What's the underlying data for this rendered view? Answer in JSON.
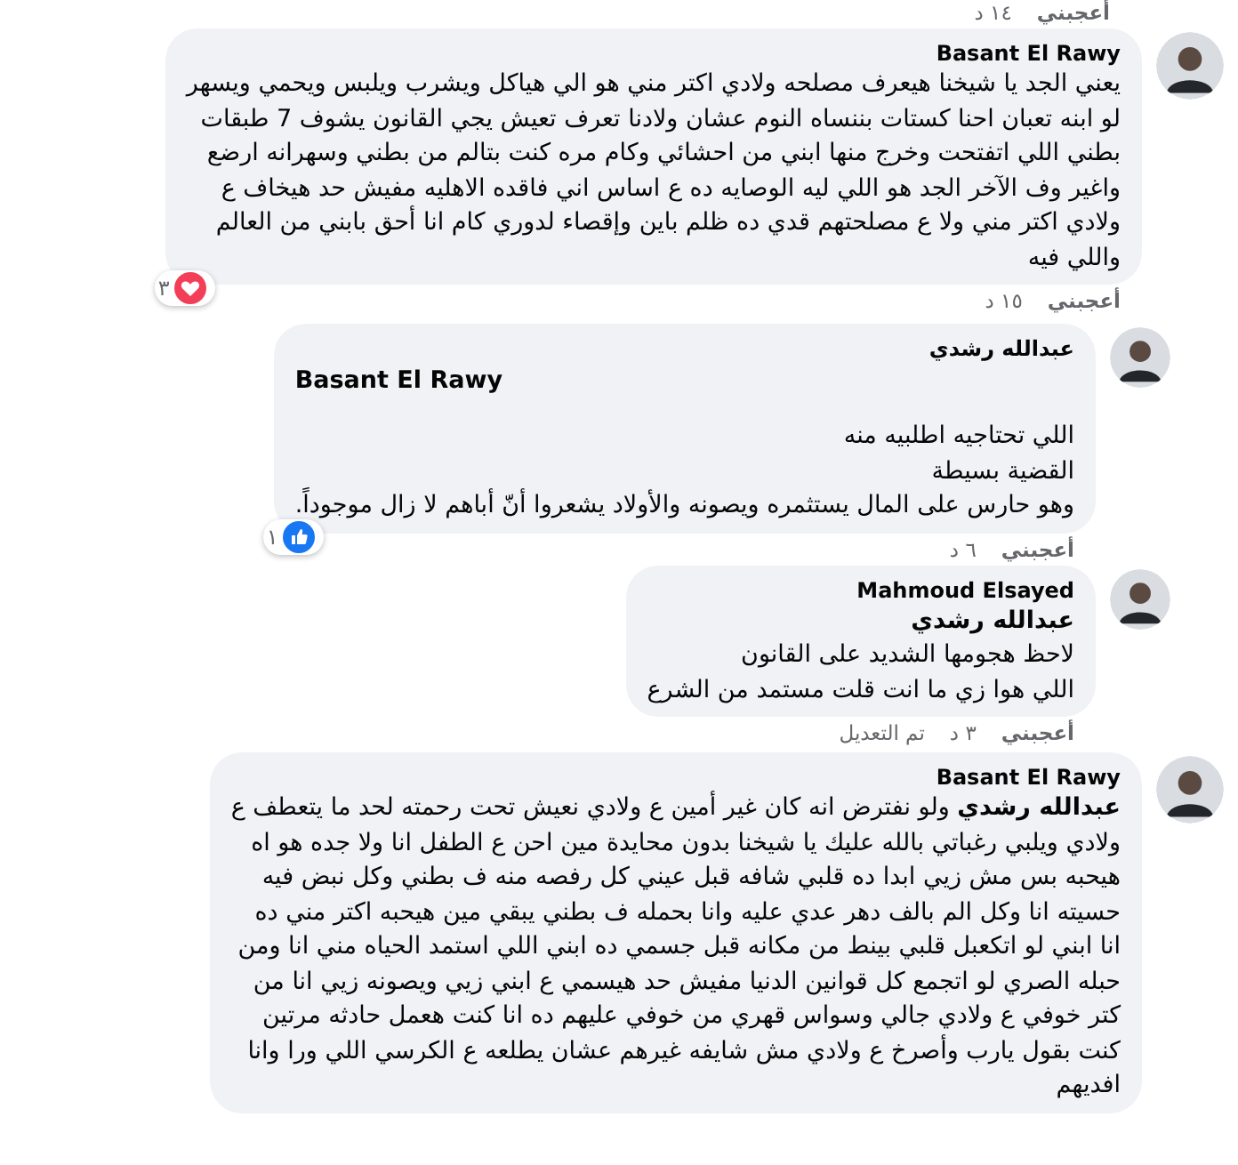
{
  "top_footer": {
    "like": "أعجبني",
    "time": "١٤ د"
  },
  "comments": [
    {
      "author": "Basant El Rawy",
      "reply": false,
      "lines": [
        "يعني الجد يا شيخنا هيعرف مصلحه ولادي اكتر مني هو الي هياكل ويشرب ويلبس ويحمي ويسهر",
        "لو ابنه تعبان احنا كستات بننساه النوم عشان ولادنا تعرف تعيش يجي القانون يشوف 7 طبقات",
        "بطني اللي اتفتحت وخرج منها ابني من احشائي وكام مره كنت بتالم من بطني وسهرانه ارضع",
        "واغير وف الآخر الجد هو اللي ليه الوصايه ده ع اساس اني فاقده الاهليه مفيش حد هيخاف ع",
        "ولادي اكتر مني ولا ع مصلحتهم قدي ده ظلم باين وإقصاء لدوري كام انا أحق بابني من العالم",
        "واللي فيه"
      ],
      "reaction": {
        "kind": "heart",
        "count": "٣"
      },
      "footer": {
        "like": "أعجبني",
        "time": "١٥ د"
      }
    },
    {
      "author": "عبدالله رشدي",
      "reply": true,
      "tag": "Basant El Rawy",
      "lines": [
        "اللي تحتاجيه اطلبيه منه",
        "القضية بسيطة",
        "وهو حارس على المال يستثمره ويصونه والأولاد يشعروا أنّ أباهم لا زال موجوداً."
      ],
      "reaction": {
        "kind": "like",
        "count": "١"
      },
      "footer": {
        "like": "أعجبني",
        "time": "٦ د"
      }
    },
    {
      "author": "Mahmoud Elsayed",
      "reply": true,
      "lines": [
        "**عبدالله رشدي**",
        "لاحظ هجومها الشديد على القانون",
        "اللي هوا زي ما انت قلت مستمد من الشرع"
      ],
      "footer": {
        "like": "أعجبني",
        "time": "٣ د",
        "edited": "تم التعديل"
      }
    },
    {
      "author": "Basant El Rawy",
      "reply": false,
      "lines": [
        "**عبدالله رشدي** ولو نفترض انه كان غير أمين ع ولادي نعيش تحت رحمته لحد ما يتعطف ع",
        "ولادي ويلبي رغباتي بالله عليك يا شيخنا بدون محايدة مين احن ع الطفل انا ولا جده هو اه",
        "هيحبه بس مش زيي ابدا ده قلبي شافه قبل عيني كل رفصه منه ف بطني وكل نبض فيه",
        "حسيته انا وكل الم بالف دهر عدي عليه وانا بحمله ف بطني يبقي مين هيحبه اكتر مني ده",
        "انا ابني لو اتكعبل قلبي بينط من مكانه قبل جسمي ده ابني اللي استمد الحياه مني انا ومن",
        "حبله الصري لو اتجمع كل قوانين الدنيا مفيش حد هيسمي ع ابني زيي ويصونه زيي انا من",
        "كتر خوفي ع ولادي جالي وسواس قهري من خوفي عليهم ده انا كنت هعمل حادثه مرتين",
        "كنت بقول يارب وأصرخ ع ولادي مش شايفه غيرهم عشان يطلعه ع الكرسي اللي ورا وانا",
        "افديهم"
      ]
    }
  ]
}
